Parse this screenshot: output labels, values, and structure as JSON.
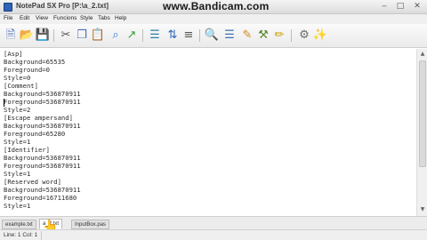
{
  "window": {
    "title": "NotePad SX Pro [P:\\a_2.txt]",
    "watermark": "www.Bandicam.com",
    "controls": {
      "minimize": "‒",
      "maximize": "□",
      "close": "✕"
    }
  },
  "menu": [
    "File",
    "Edit",
    "View",
    "Funcions",
    "Style",
    "Tabs",
    "Help"
  ],
  "toolbar": {
    "buttons": [
      {
        "name": "new-file-icon",
        "glyph": "🗎",
        "color": "#4a6fb3"
      },
      {
        "name": "open-folder-icon",
        "glyph": "📂",
        "color": "#d9a520"
      },
      {
        "name": "save-icon",
        "glyph": "💾",
        "color": "#2d5fa8"
      },
      {
        "name": "cut-icon",
        "glyph": "✂",
        "color": "#555555"
      },
      {
        "name": "copy-icon",
        "glyph": "❐",
        "color": "#4a6fb3"
      },
      {
        "name": "paste-icon",
        "glyph": "📋",
        "color": "#b07d3a"
      },
      {
        "name": "find-icon",
        "glyph": "⌕",
        "color": "#3a7bd5"
      },
      {
        "name": "replace-icon",
        "glyph": "↗",
        "color": "#3b9b3b"
      },
      {
        "name": "chart-icon",
        "glyph": "☰",
        "color": "#2f7fa3"
      },
      {
        "name": "sort-icon",
        "glyph": "⇅",
        "color": "#2b63b8"
      },
      {
        "name": "list-icon",
        "glyph": "≡",
        "color": "#555555"
      },
      {
        "name": "zoom-icon",
        "glyph": "🔍",
        "color": "#3a3a3a"
      },
      {
        "name": "text-tool-icon",
        "glyph": "☰",
        "color": "#3a6fb5"
      },
      {
        "name": "pen-icon",
        "glyph": "✎",
        "color": "#d08a1c"
      },
      {
        "name": "tools-icon",
        "glyph": "⚒",
        "color": "#5a8a2e"
      },
      {
        "name": "marker-icon",
        "glyph": "✏",
        "color": "#c9a000"
      },
      {
        "name": "settings-icon",
        "glyph": "⚙",
        "color": "#6b6b6b"
      },
      {
        "name": "magic-icon",
        "glyph": "✨",
        "color": "#c0392b"
      }
    ]
  },
  "editor": {
    "lines": [
      "[Asp]",
      "Background=65535",
      "Foreground=0",
      "Style=0",
      "[Comment]",
      "Background=536870911",
      "Foreground=536870911",
      "Style=2",
      "[Escape ampersand]",
      "Background=536870911",
      "Foreground=65280",
      "Style=1",
      "[Identifier]",
      "Background=536870911",
      "Foreground=536870911",
      "Style=1",
      "[Reserved word]",
      "Background=536870911",
      "Foreground=16711680",
      "Style=1"
    ]
  },
  "tabs": [
    {
      "label": "example.txt",
      "active": false
    },
    {
      "label": "a_2.txt",
      "active": true
    },
    {
      "label": "InputBox.pas",
      "active": false
    }
  ],
  "status": {
    "position": "Line: 1  Col: 1"
  }
}
